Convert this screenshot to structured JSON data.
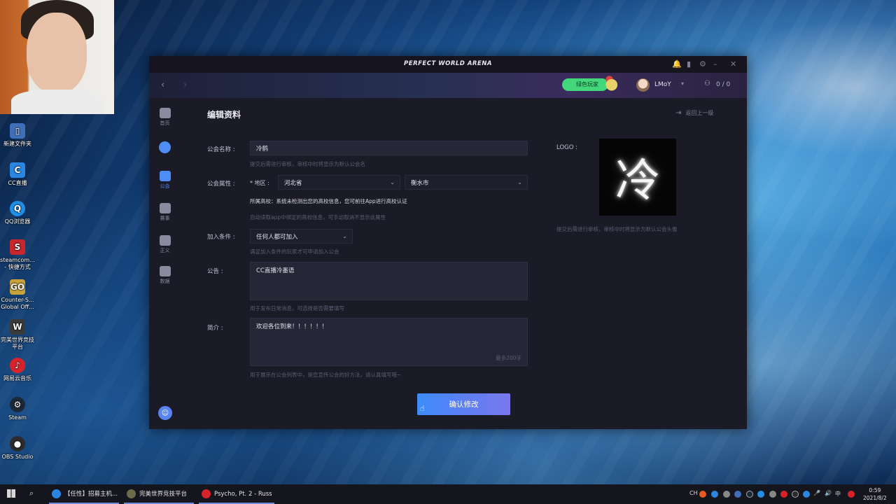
{
  "window": {
    "title": "PERFECT WORLD ARENA"
  },
  "topbar": {
    "badge_label": "绿色玩家",
    "username": "LMoY",
    "friends_count": "0 / 0"
  },
  "sidebar": {
    "items": [
      {
        "label": "首页",
        "icon": "home-icon"
      },
      {
        "label": "",
        "icon": "game-ball-icon"
      },
      {
        "label": "公会",
        "icon": "guild-icon"
      },
      {
        "label": "赛事",
        "icon": "trophy-icon"
      },
      {
        "label": "正义",
        "icon": "scale-icon"
      },
      {
        "label": "数据",
        "icon": "chart-icon"
      }
    ]
  },
  "page": {
    "title": "编辑资料",
    "back_label": "返回上一级"
  },
  "form": {
    "name_label": "公会名称 :",
    "name_value": "冷鹤",
    "name_hint": "提交后需进行审核，审核中时将显示为默认公会名",
    "attr_label": "公会属性 :",
    "region_label": "* 地区 :",
    "province_value": "河北省",
    "city_value": "衡水市",
    "school_notice": "所属高校：系统未检测出您的高校信息，您可前往App进行高校认证",
    "school_hint": "自动读取app中绑定的高校信息，可手动取消不显示此属性",
    "join_label": "加入条件 :",
    "join_value": "任何人都可加入",
    "join_hint": "满足加入条件的玩家才可申请加入公会",
    "notice_label": "公告 :",
    "notice_value": "CC直播冷墨语",
    "notice_hint": "用于发布日常消息，可选择是否需要填写",
    "intro_label": "简介 :",
    "intro_value": "欢迎各位到来！！！！！！",
    "intro_counter": "最多200字",
    "intro_hint": "用于展示在公会列表中，是您宣传公会的好方法，请认真填写哦~",
    "logo_label": "LOGO :",
    "logo_char": "冷",
    "logo_hint": "提交后需进行审核，审核中时将显示为默认公会头像",
    "confirm_label": "确认修改"
  },
  "desktop": {
    "icons": [
      {
        "label": "新建文件夹",
        "color": "#3f6fb8"
      },
      {
        "label": "CC直播",
        "color": "#2a86e0"
      },
      {
        "label": "QQ浏览器",
        "color": "#1f8fe8"
      },
      {
        "label": "steamcom... - 快捷方式",
        "color": "#c8272c"
      },
      {
        "label": "Counter-S... Global Off...",
        "color": "#c9a23a"
      },
      {
        "label": "完美世界竞技平台",
        "color": "#3a3a3a"
      },
      {
        "label": "网易云音乐",
        "color": "#d8232a"
      },
      {
        "label": "Steam",
        "color": "#1b2838"
      },
      {
        "label": "OBS Studio",
        "color": "#2b2b2b"
      }
    ]
  },
  "taskbar": {
    "tasks": [
      {
        "label": "【任性】招募主机...",
        "color": "#2a86e0"
      },
      {
        "label": "完美世界竞技平台",
        "color": "#6b6b4a"
      },
      {
        "label": "Psycho, Pt. 2 - Russ",
        "color": "#d8232a"
      }
    ],
    "tray_lang": "中",
    "tray_ch": "CH",
    "time": "0:59",
    "date": "2021/8/2"
  }
}
